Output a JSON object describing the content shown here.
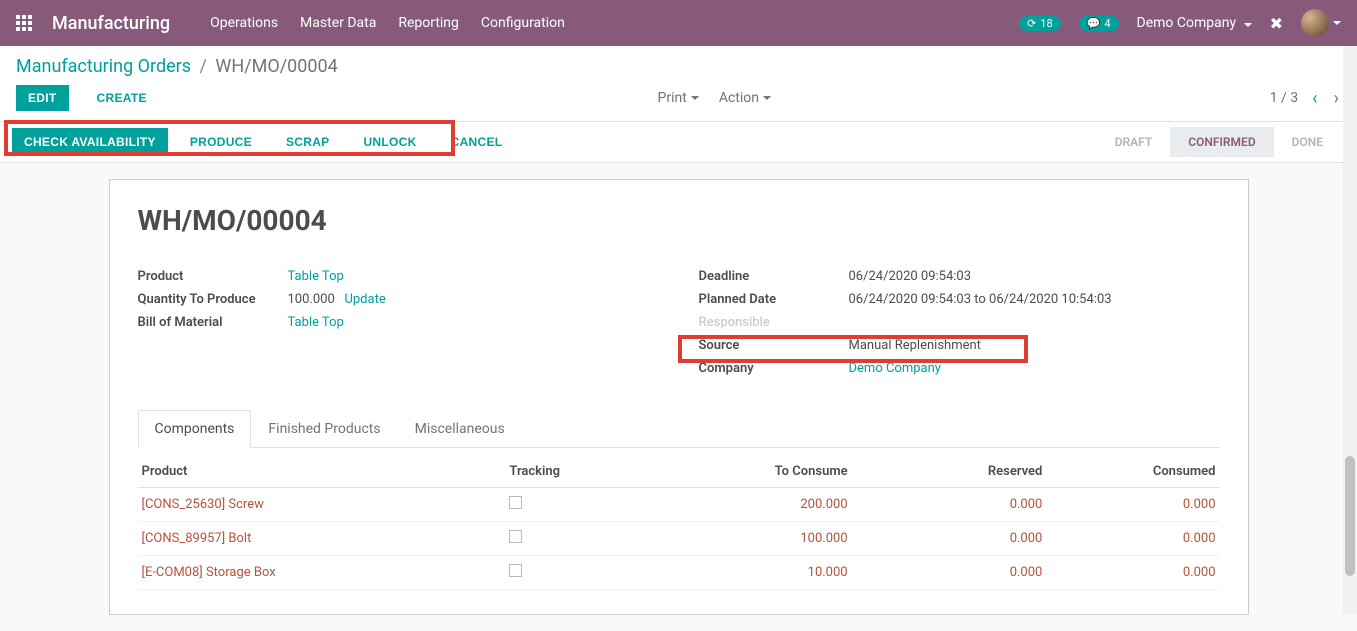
{
  "navbar": {
    "brand": "Manufacturing",
    "menu": [
      "Operations",
      "Master Data",
      "Reporting",
      "Configuration"
    ],
    "activity_count": "18",
    "message_count": "4",
    "company": "Demo Company"
  },
  "breadcrumb": {
    "parent": "Manufacturing Orders",
    "current": "WH/MO/00004"
  },
  "buttons": {
    "edit": "EDIT",
    "create": "CREATE",
    "print": "Print",
    "action": "Action",
    "check_availability": "CHECK AVAILABILITY",
    "produce": "PRODUCE",
    "scrap": "SCRAP",
    "unlock": "UNLOCK",
    "cancel": "CANCEL"
  },
  "pager": {
    "text": "1 / 3"
  },
  "status": {
    "draft": "DRAFT",
    "confirmed": "CONFIRMED",
    "done": "DONE"
  },
  "record": {
    "name": "WH/MO/00004",
    "labels": {
      "product": "Product",
      "qty": "Quantity To Produce",
      "bom": "Bill of Material",
      "deadline": "Deadline",
      "planned": "Planned Date",
      "responsible": "Responsible",
      "source": "Source",
      "company": "Company"
    },
    "product": "Table Top",
    "qty": "100.000",
    "update": "Update",
    "bom": "Table Top",
    "deadline": "06/24/2020 09:54:03",
    "planned": "06/24/2020 09:54:03 to 06/24/2020 10:54:03",
    "source": "Manual Replenishment",
    "company": "Demo Company"
  },
  "tabs": {
    "components": "Components",
    "finished": "Finished Products",
    "misc": "Miscellaneous"
  },
  "table": {
    "headers": {
      "product": "Product",
      "tracking": "Tracking",
      "to_consume": "To Consume",
      "reserved": "Reserved",
      "consumed": "Consumed"
    },
    "rows": [
      {
        "product": "[CONS_25630] Screw",
        "to_consume": "200.000",
        "reserved": "0.000",
        "consumed": "0.000"
      },
      {
        "product": "[CONS_89957] Bolt",
        "to_consume": "100.000",
        "reserved": "0.000",
        "consumed": "0.000"
      },
      {
        "product": "[E-COM08] Storage Box",
        "to_consume": "10.000",
        "reserved": "0.000",
        "consumed": "0.000"
      }
    ]
  }
}
